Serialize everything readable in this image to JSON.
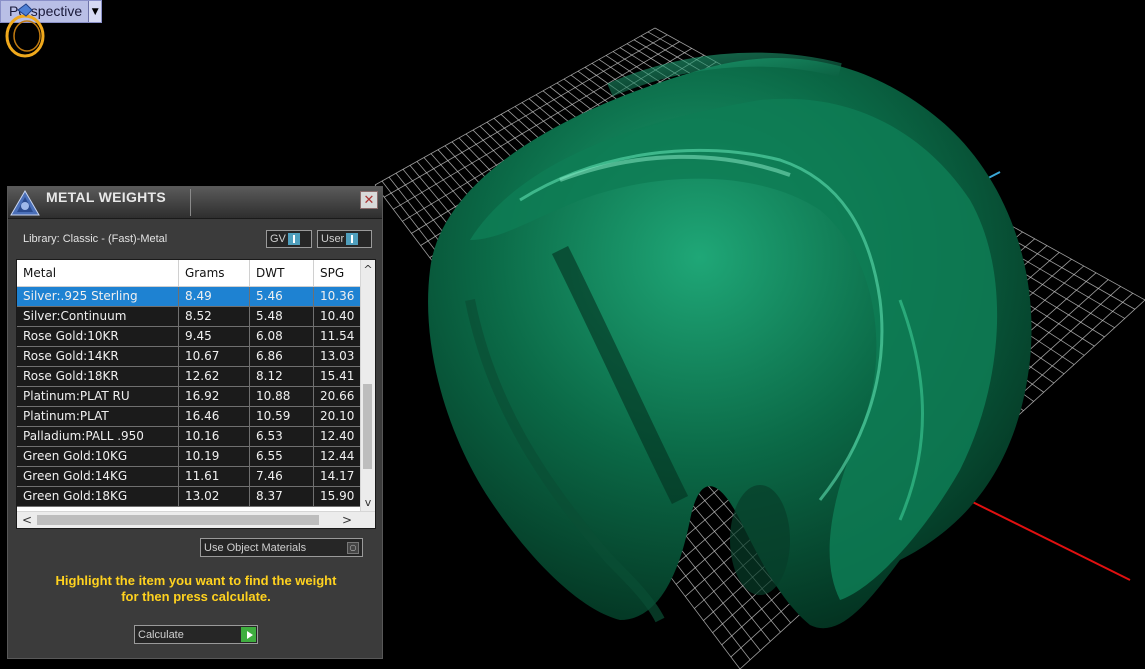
{
  "viewport": {
    "label": "Perspective",
    "dropdown_icon": "chevron-down-icon"
  },
  "panel": {
    "title": "METAL WEIGHTS",
    "close_icon": "close-icon",
    "logo_icon": "matrix-logo-icon",
    "library_label": "Library: Classic - (Fast)-Metal",
    "gv_label": "GV",
    "user_label": "User",
    "table": {
      "columns": [
        "Metal",
        "Grams",
        "DWT",
        "SPG"
      ],
      "rows": [
        [
          "Silver:.925 Sterling",
          "8.49",
          "5.46",
          "10.36"
        ],
        [
          "Silver:Continuum",
          "8.52",
          "5.48",
          "10.40"
        ],
        [
          "Rose Gold:10KR",
          "9.45",
          "6.08",
          "11.54"
        ],
        [
          "Rose Gold:14KR",
          "10.67",
          "6.86",
          "13.03"
        ],
        [
          "Rose Gold:18KR",
          "12.62",
          "8.12",
          "15.41"
        ],
        [
          "Platinum:PLAT RU",
          "16.92",
          "10.88",
          "20.66"
        ],
        [
          "Platinum:PLAT",
          "16.46",
          "10.59",
          "20.10"
        ],
        [
          "Palladium:PALL .950",
          "10.16",
          "6.53",
          "12.40"
        ],
        [
          "Green Gold:10KG",
          "10.19",
          "6.55",
          "12.44"
        ],
        [
          "Green Gold:14KG",
          "11.61",
          "7.46",
          "14.17"
        ],
        [
          "Green Gold:18KG",
          "13.02",
          "8.37",
          "15.90"
        ]
      ],
      "selected_row": 0
    },
    "use_object_materials_label": "Use Object Materials",
    "hint_line1": "Highlight the item you want to find the weight",
    "hint_line2": "for then press calculate.",
    "calculate_label": "Calculate"
  },
  "colors": {
    "background": "#000000",
    "grid": "#cfcfcf",
    "axis_x": "#e01010",
    "axis_y": "#3aa8d8",
    "model": "#0a6e4a",
    "selection": "#1e82d2",
    "hint": "#ffd21f"
  }
}
